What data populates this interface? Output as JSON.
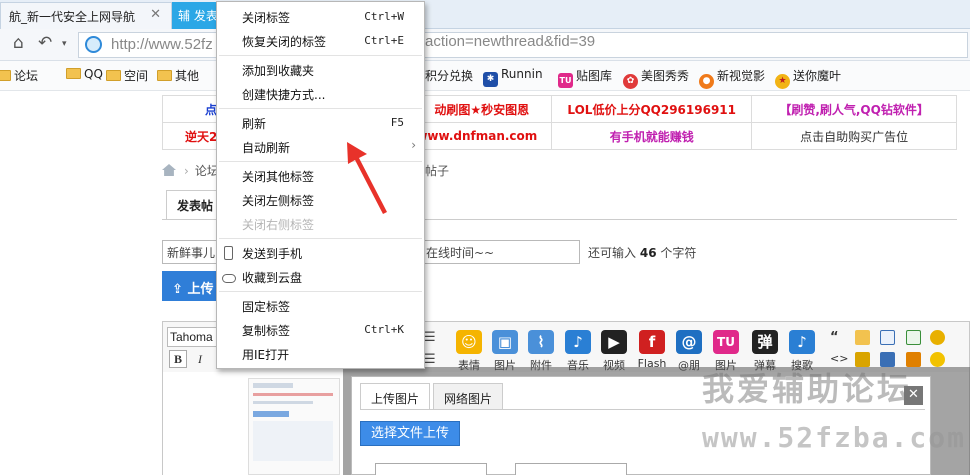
{
  "browser": {
    "tabs": [
      {
        "label": "航_新一代安全上网导航",
        "close": "✕"
      },
      {
        "label": "辅 发表"
      }
    ],
    "address_url": "http://www.52fz",
    "address_url_tail": "action=newthread&fid=39"
  },
  "favorites": [
    {
      "label": "论坛",
      "icon": "folder"
    },
    {
      "label": "QQ",
      "icon": "folder"
    },
    {
      "label": "空间",
      "icon": "folder"
    },
    {
      "label": "其他",
      "icon": "folder"
    },
    {
      "label": "积分兑换"
    },
    {
      "label": "Runnin",
      "icon": "paw"
    },
    {
      "label": "贴图库",
      "icon": "TU"
    },
    {
      "label": "美图秀秀",
      "icon": "meitu"
    },
    {
      "label": "新视觉影",
      "icon": "film"
    },
    {
      "label": "送你魔叶",
      "icon": "gift"
    }
  ],
  "ads": [
    [
      "点",
      "动刷图★秒安图恩",
      "LOL低价上分QQ296196911",
      "【刷赞,刷人气,QQ钻软件】"
    ],
    [
      "逆天2",
      "www.dnfman.com",
      "有手机就能赚钱",
      "点击自助购买广告位"
    ]
  ],
  "ad_colors": {
    "blue": "#1a3fd0",
    "red": "#e01010",
    "purple": "#c020b0",
    "gray": "#333333"
  },
  "breadcrumb": {
    "first": "论坛",
    "last": "帖子"
  },
  "post": {
    "tab_label": "发表帖",
    "subject_value": "新鲜事儿",
    "subject_value_tail": "在线时间~~",
    "remain_prefix": "还可输入",
    "remain_count": "46",
    "remain_suffix": "个字符",
    "upload_label": "上传"
  },
  "editor": {
    "font": "Tahoma",
    "bold": "B",
    "italic": "I",
    "tools": [
      {
        "label": "表情",
        "icon": "smiley-icon",
        "color": "#f5b400",
        "glyph": "☺"
      },
      {
        "label": "图片",
        "icon": "image-icon",
        "color": "#4a90d9",
        "glyph": "▣"
      },
      {
        "label": "附件",
        "icon": "paperclip-icon",
        "color": "#4a90d9",
        "glyph": "⌇"
      },
      {
        "label": "音乐",
        "icon": "music-icon",
        "color": "#2a7fd4",
        "glyph": "♪"
      },
      {
        "label": "视频",
        "icon": "clapper-icon",
        "color": "#222222",
        "glyph": "▶"
      },
      {
        "label": "Flash",
        "icon": "flash-icon",
        "color": "#d02020",
        "glyph": "f"
      },
      {
        "label": "@朋",
        "icon": "at-icon",
        "color": "#1e6fc2",
        "glyph": "@"
      },
      {
        "label": "图片",
        "icon": "tu-icon",
        "color": "#e0298a",
        "glyph": "TU"
      },
      {
        "label": "弹幕",
        "icon": "danmu-icon",
        "color": "#222222",
        "glyph": "弹"
      },
      {
        "label": "搜歌",
        "icon": "note-icon",
        "color": "#2a7fd4",
        "glyph": "♪"
      }
    ]
  },
  "upload_dialog": {
    "tabs": [
      "上传图片",
      "网络图片"
    ],
    "choose_label": "选择文件上传",
    "close": "✕"
  },
  "watermark": {
    "title": "我爱辅助论坛",
    "url": "www.52fzba.com"
  },
  "context_menu": [
    {
      "label": "关闭标签",
      "shortcut": "Ctrl+W"
    },
    {
      "label": "恢复关闭的标签",
      "shortcut": "Ctrl+E"
    },
    {
      "label": "添加到收藏夹"
    },
    {
      "label": "创建快捷方式..."
    },
    {
      "label": "刷新",
      "shortcut": "F5"
    },
    {
      "label": "自动刷新",
      "submenu": "›"
    },
    {
      "label": "关闭其他标签"
    },
    {
      "label": "关闭左侧标签"
    },
    {
      "label": "关闭右侧标签",
      "disabled": true
    },
    {
      "label": "发送到手机",
      "icon": "phone-icon"
    },
    {
      "label": "收藏到云盘",
      "icon": "cloud-icon"
    },
    {
      "label": "固定标签"
    },
    {
      "label": "复制标签",
      "shortcut": "Ctrl+K"
    },
    {
      "label": "用IE打开"
    }
  ],
  "annotation_color": "#e8322a"
}
